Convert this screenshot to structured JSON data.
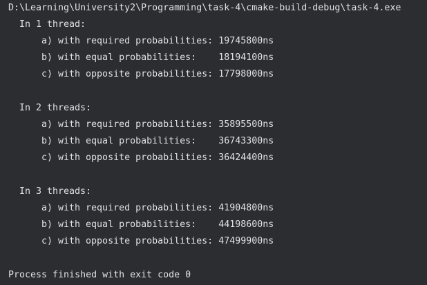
{
  "console": {
    "command": "D:\\Learning\\University2\\Programming\\task-4\\cmake-build-debug\\task-4.exe",
    "groups": [
      {
        "title": "In 1 thread:",
        "rows": [
          {
            "label": "a) with required probabilities:",
            "value": "19745800ns"
          },
          {
            "label": "b) with equal probabilities:   ",
            "value": "18194100ns"
          },
          {
            "label": "c) with opposite probabilities:",
            "value": "17798000ns"
          }
        ]
      },
      {
        "title": "In 2 threads:",
        "rows": [
          {
            "label": "a) with required probabilities:",
            "value": "35895500ns"
          },
          {
            "label": "b) with equal probabilities:   ",
            "value": "36743300ns"
          },
          {
            "label": "c) with opposite probabilities:",
            "value": "36424400ns"
          }
        ]
      },
      {
        "title": "In 3 threads:",
        "rows": [
          {
            "label": "a) with required probabilities:",
            "value": "41904800ns"
          },
          {
            "label": "b) with equal probabilities:   ",
            "value": "44198600ns"
          },
          {
            "label": "c) with opposite probabilities:",
            "value": "47499900ns"
          }
        ]
      }
    ],
    "exit_message": "Process finished with exit code 0"
  },
  "colors": {
    "background": "#2b2d30",
    "text": "#dfe1e5"
  }
}
